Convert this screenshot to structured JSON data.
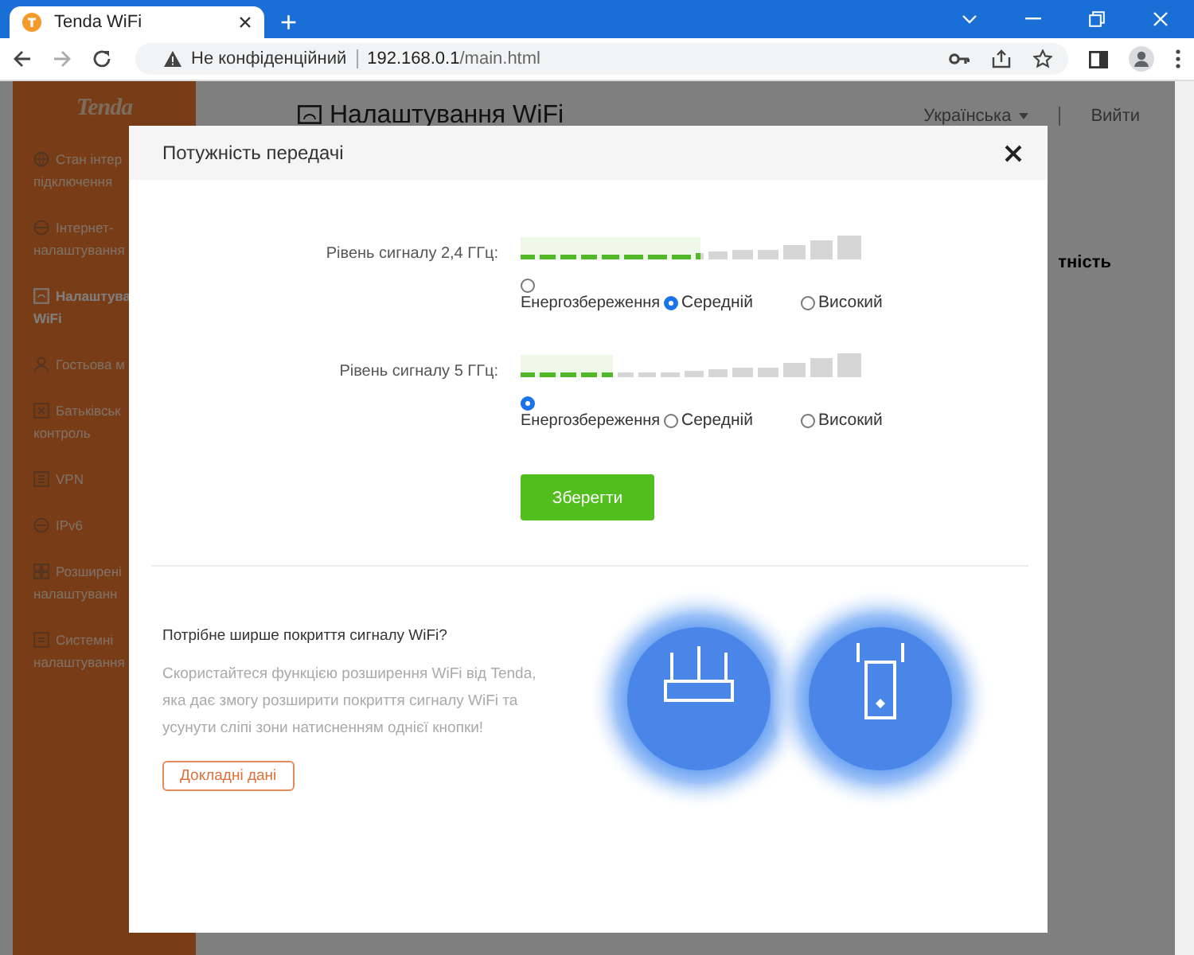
{
  "browser": {
    "tabs": [
      {
        "title": "Tenda WiFi",
        "selected": true
      }
    ],
    "new_tab": "+",
    "security_label": "Не конфіденційний",
    "url_host": "192.168.0.1",
    "url_path": "/main.html"
  },
  "sidebar": {
    "logo": "Tenda",
    "items": [
      {
        "lines": [
          "Стан інтер",
          "підключення"
        ],
        "selected": false
      },
      {
        "lines": [
          "Інтернет-",
          "налаштування"
        ],
        "selected": false
      },
      {
        "lines": [
          "Налаштува",
          "WiFi"
        ],
        "selected": true
      },
      {
        "lines": [
          "Гостьова м"
        ],
        "selected": false
      },
      {
        "lines": [
          "Батьківськ",
          "контроль"
        ],
        "selected": false
      },
      {
        "lines": [
          "VPN"
        ],
        "selected": false
      },
      {
        "lines": [
          "IPv6"
        ],
        "selected": false
      },
      {
        "lines": [
          "Розширені",
          "налаштуванн"
        ],
        "selected": false
      },
      {
        "lines": [
          "Системні",
          "налаштування"
        ],
        "selected": false
      }
    ]
  },
  "header": {
    "title": "Налаштування WiFi",
    "language": "Українська",
    "logout": "Вийти"
  },
  "background_text": "тність",
  "dialog": {
    "title": "Потужність передачі",
    "signal_rows": [
      {
        "label": "Рівень сигналу 2,4 ГГц:",
        "level": 0.53,
        "options": [
          {
            "label": "Енергозбереження",
            "selected": false
          },
          {
            "label": "Середній",
            "selected": true
          },
          {
            "label": "Високий",
            "selected": false
          }
        ]
      },
      {
        "label": "Рівень сигналу 5 ГГц:",
        "level": 0.27,
        "options": [
          {
            "label": "Енергозбереження",
            "selected": true
          },
          {
            "label": "Середній",
            "selected": false
          },
          {
            "label": "Високий",
            "selected": false
          }
        ]
      }
    ],
    "save_button": "Зберегти",
    "promo": {
      "title": "Потрібне ширше покриття сигналу WiFi?",
      "text": "Скористайтеся функцією розширення WiFi від Tenda, яка дає змогу розширити покриття сигналу WiFi та усунути сліпі зони натисненням однієї кнопки!",
      "button": "Докладні дані"
    }
  }
}
